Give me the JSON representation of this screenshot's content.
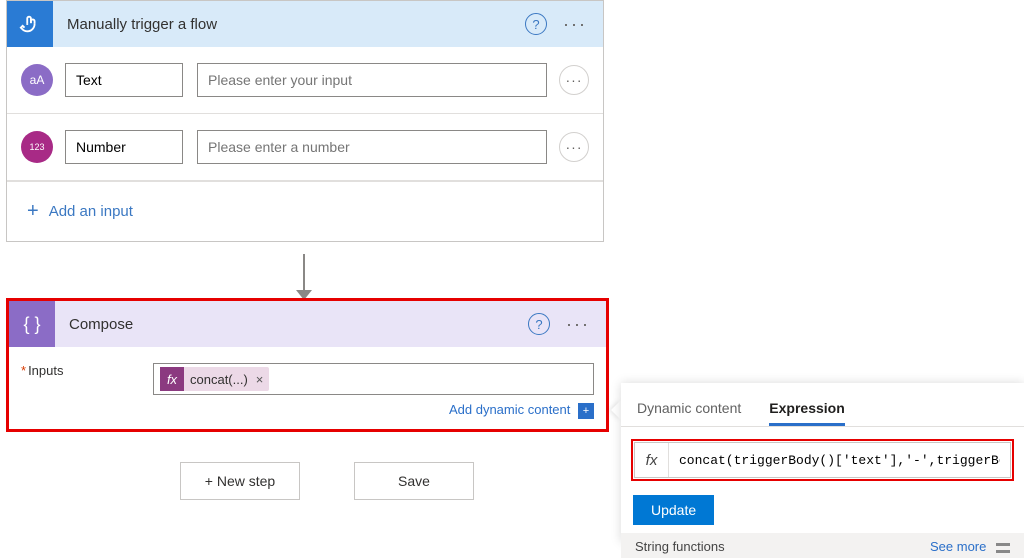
{
  "trigger": {
    "title": "Manually trigger a flow",
    "rows": [
      {
        "icon_label": "aA",
        "name": "Text",
        "placeholder": "Please enter your input"
      },
      {
        "icon_label": "123",
        "name": "Number",
        "placeholder": "Please enter a number"
      }
    ],
    "add_input_label": "Add an input"
  },
  "compose": {
    "title": "Compose",
    "inputs_label": "Inputs",
    "token_label": "concat(...)",
    "dynamic_link": "Add dynamic content",
    "dynamic_badge": "+"
  },
  "buttons": {
    "new_step": "+ New step",
    "save": "Save"
  },
  "expression_panel": {
    "tabs": {
      "dynamic": "Dynamic content",
      "expression": "Expression"
    },
    "fx_label": "fx",
    "formula": "concat(triggerBody()['text'],'-',triggerBo",
    "update": "Update",
    "section": "String functions",
    "see_more": "See more"
  }
}
